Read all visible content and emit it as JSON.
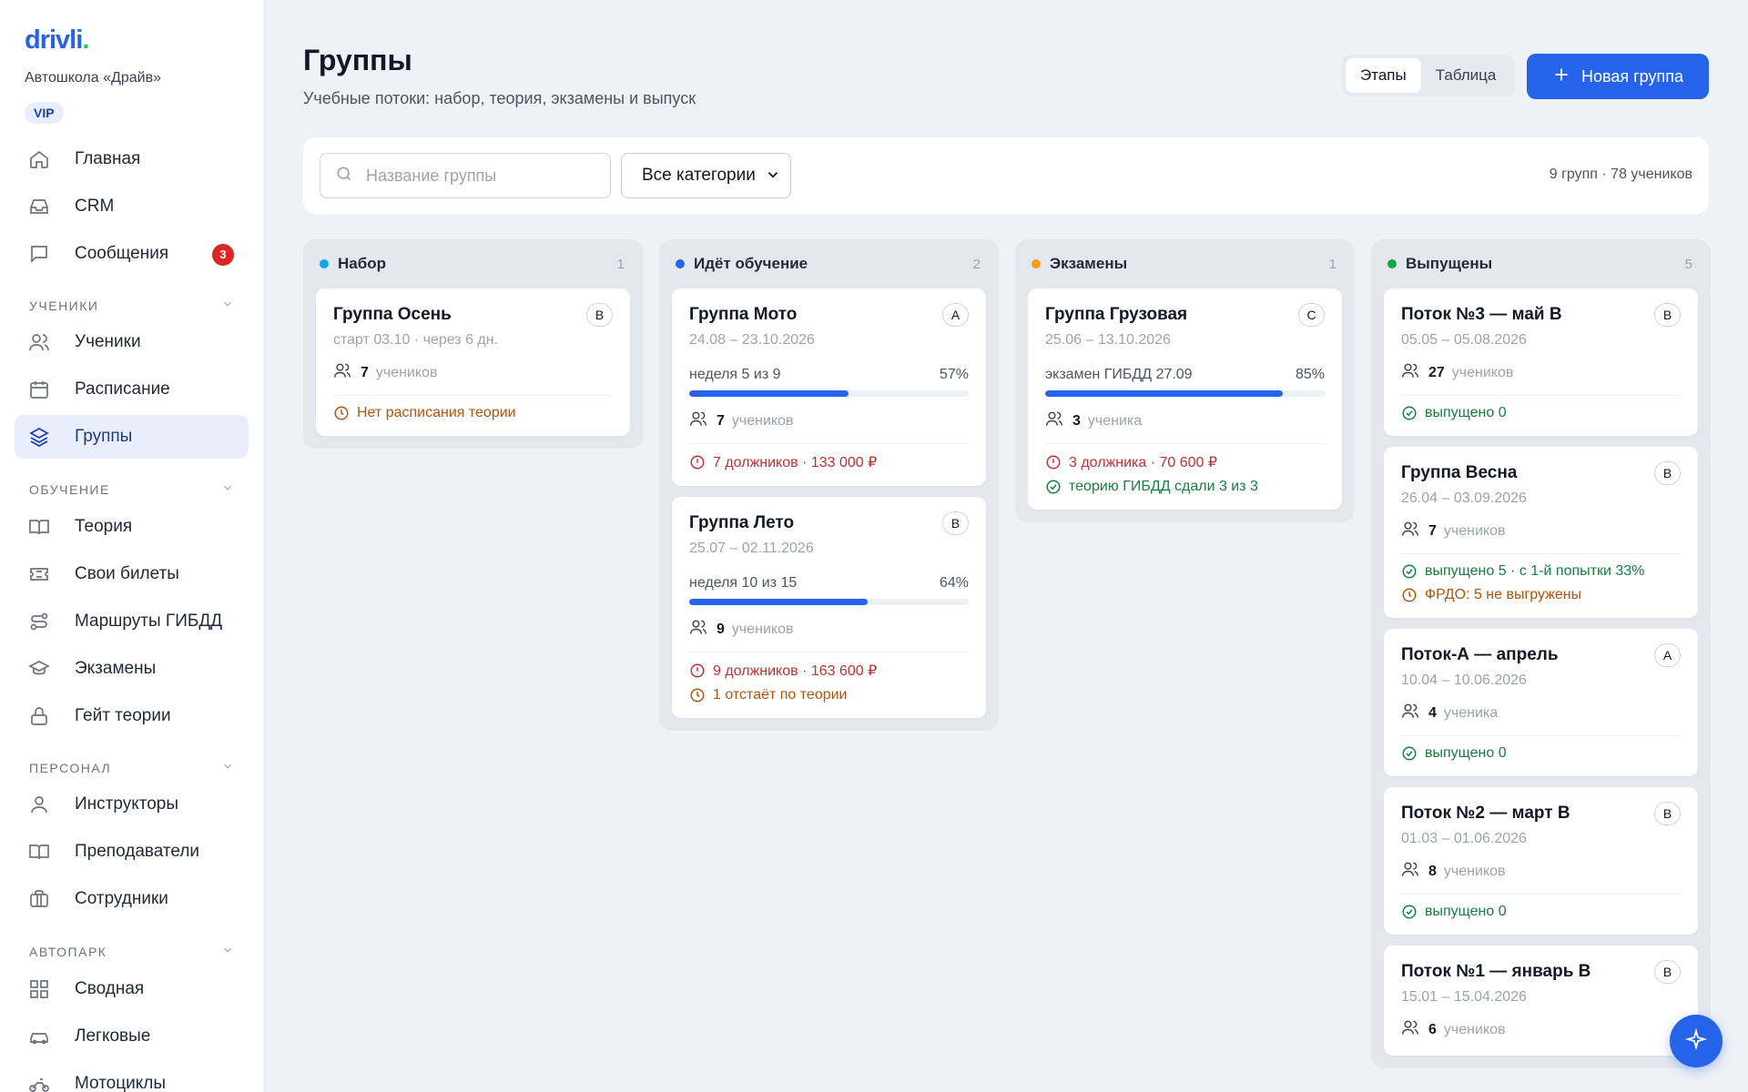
{
  "brand": {
    "logo_text": "drivli",
    "logo_dot": ".",
    "school": "Автошкола «Драйв»",
    "plan_badge": "VIP",
    "accent": "#2563eb"
  },
  "sidebar": {
    "main": [
      {
        "label": "Главная",
        "icon": "home-icon"
      },
      {
        "label": "CRM",
        "icon": "inbox-icon"
      },
      {
        "label": "Сообщения",
        "icon": "message-icon",
        "badge": "3"
      }
    ],
    "sections": [
      {
        "title": "УЧЕНИКИ",
        "items": [
          {
            "label": "Ученики",
            "icon": "users-icon"
          },
          {
            "label": "Расписание",
            "icon": "calendar-icon"
          },
          {
            "label": "Группы",
            "icon": "layers-icon",
            "active": true
          }
        ]
      },
      {
        "title": "ОБУЧЕНИЕ",
        "items": [
          {
            "label": "Теория",
            "icon": "book-icon"
          },
          {
            "label": "Свои билеты",
            "icon": "ticket-icon"
          },
          {
            "label": "Маршруты ГИБДД",
            "icon": "route-icon"
          },
          {
            "label": "Экзамены",
            "icon": "graduation-cap-icon"
          },
          {
            "label": "Гейт теории",
            "icon": "lock-icon"
          }
        ]
      },
      {
        "title": "ПЕРСОНАЛ",
        "items": [
          {
            "label": "Инструкторы",
            "icon": "user-icon"
          },
          {
            "label": "Преподаватели",
            "icon": "book-open-icon"
          },
          {
            "label": "Сотрудники",
            "icon": "briefcase-icon"
          }
        ]
      },
      {
        "title": "АВТОПАРК",
        "items": [
          {
            "label": "Сводная",
            "icon": "grid-icon"
          },
          {
            "label": "Легковые",
            "icon": "car-icon"
          },
          {
            "label": "Мотоциклы",
            "icon": "motorcycle-icon"
          }
        ]
      }
    ]
  },
  "header": {
    "title": "Группы",
    "subtitle": "Учебные потоки: набор, теория, экзамены и выпуск",
    "view_tabs": [
      {
        "label": "Этапы",
        "active": true
      },
      {
        "label": "Таблица",
        "active": false
      }
    ],
    "new_button": "Новая группа"
  },
  "filters": {
    "search_placeholder": "Название группы",
    "search_value": "",
    "category_selected": "Все категории",
    "summary": "9 групп · 78 учеников"
  },
  "columns": [
    {
      "title": "Набор",
      "count": "1",
      "color": "#0ea5e9",
      "cards": [
        {
          "name": "Группа Осень",
          "cat": "B",
          "dates": "старт 03.10 · через 6 дн.",
          "students": "7",
          "students_word": "учеников",
          "notes": [
            {
              "text": "Нет расписания теории",
              "type": "orange",
              "icon": "clock-icon"
            }
          ]
        }
      ]
    },
    {
      "title": "Идёт обучение",
      "count": "2",
      "color": "#2563eb",
      "cards": [
        {
          "name": "Группа Мото",
          "cat": "A",
          "dates": "24.08 – 23.10.2026",
          "progress_label": "неделя 5 из 9",
          "progress_pct": "57%",
          "progress": 57,
          "students": "7",
          "students_word": "учеников",
          "notes": [
            {
              "text": "7 должников · 133 000 ₽",
              "type": "red",
              "icon": "alert-circle-icon"
            }
          ]
        },
        {
          "name": "Группа Лето",
          "cat": "B",
          "dates": "25.07 – 02.11.2026",
          "progress_label": "неделя 10 из 15",
          "progress_pct": "64%",
          "progress": 64,
          "students": "9",
          "students_word": "учеников",
          "notes": [
            {
              "text": "9 должников · 163 600 ₽",
              "type": "red",
              "icon": "alert-circle-icon"
            },
            {
              "text": "1 отстаёт по теории",
              "type": "orange",
              "icon": "clock-icon"
            }
          ]
        }
      ]
    },
    {
      "title": "Экзамены",
      "count": "1",
      "color": "#f59e0b",
      "cards": [
        {
          "name": "Группа Грузовая",
          "cat": "C",
          "dates": "25.06 – 13.10.2026",
          "progress_label": "экзамен ГИБДД 27.09",
          "progress_pct": "85%",
          "progress": 85,
          "students": "3",
          "students_word": "ученика",
          "notes": [
            {
              "text": "3 должника · 70 600 ₽",
              "type": "red",
              "icon": "alert-circle-icon"
            },
            {
              "text": "теорию ГИБДД сдали 3 из 3",
              "type": "green",
              "icon": "check-circle-icon"
            }
          ]
        }
      ]
    },
    {
      "title": "Выпущены",
      "count": "5",
      "color": "#16a34a",
      "cards": [
        {
          "name": "Поток №3 — май B",
          "cat": "B",
          "dates": "05.05 – 05.08.2026",
          "students": "27",
          "students_word": "учеников",
          "notes": [
            {
              "text": "выпущено 0",
              "type": "green",
              "icon": "check-circle-icon"
            }
          ]
        },
        {
          "name": "Группа Весна",
          "cat": "B",
          "dates": "26.04 – 03.09.2026",
          "students": "7",
          "students_word": "учеников",
          "notes": [
            {
              "text": "выпущено 5 · с 1-й попытки 33%",
              "type": "green",
              "icon": "check-circle-icon"
            },
            {
              "text": "ФРДО: 5 не выгружены",
              "type": "orange",
              "icon": "clock-icon"
            }
          ]
        },
        {
          "name": "Поток-А — апрель",
          "cat": "A",
          "dates": "10.04 – 10.06.2026",
          "students": "4",
          "students_word": "ученика",
          "notes": [
            {
              "text": "выпущено 0",
              "type": "green",
              "icon": "check-circle-icon"
            }
          ]
        },
        {
          "name": "Поток №2 — март B",
          "cat": "B",
          "dates": "01.03 – 01.06.2026",
          "students": "8",
          "students_word": "учеников",
          "notes": [
            {
              "text": "выпущено 0",
              "type": "green",
              "icon": "check-circle-icon"
            }
          ]
        },
        {
          "name": "Поток №1 — январь B",
          "cat": "B",
          "dates": "15.01 – 15.04.2026",
          "students": "6",
          "students_word": "учеников",
          "notes": []
        }
      ]
    }
  ],
  "fab": {
    "icon": "sparkle-icon"
  }
}
